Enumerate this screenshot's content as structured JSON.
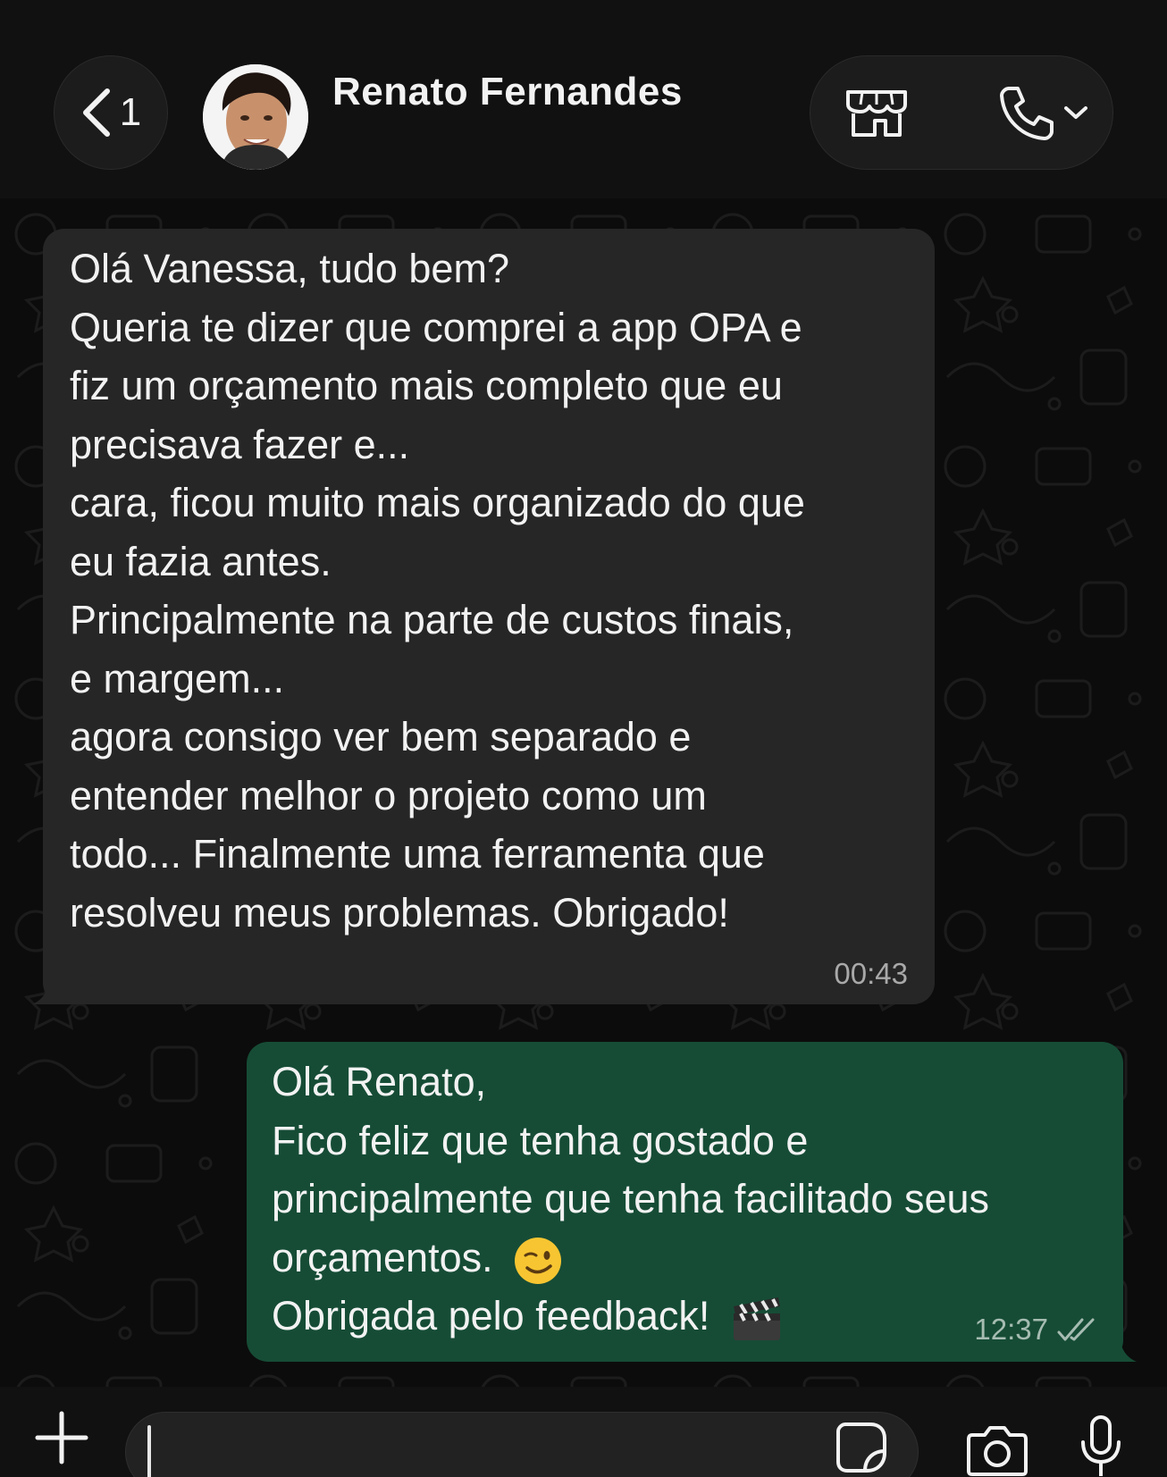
{
  "header": {
    "back_count": "1",
    "contact_name": "Renato Fernandes",
    "icons": {
      "back": "chevron-left-icon",
      "store": "storefront-icon",
      "call": "phone-icon",
      "call_menu": "chevron-down-icon"
    }
  },
  "messages": [
    {
      "direction": "incoming",
      "lines": [
        "Olá Vanessa, tudo bem?",
        "Queria te dizer que comprei a app OPA e",
        "fiz um orçamento mais completo que eu",
        "precisava fazer e...",
        "cara, ficou muito mais organizado do que",
        "eu fazia antes.",
        "Principalmente na parte de custos finais,",
        "e margem...",
        "agora consigo ver bem separado e",
        "entender melhor o projeto como um",
        "todo... Finalmente uma ferramenta que",
        "resolveu meus problemas. Obrigado!"
      ],
      "time": "00:43"
    },
    {
      "direction": "outgoing",
      "lines": [
        "Olá Renato,",
        "Fico feliz que tenha gostado e",
        "principalmente que tenha facilitado seus",
        "orçamentos.",
        "Obrigada pelo feedback!"
      ],
      "time": "12:37",
      "status": "read-double-check-icon",
      "emojis": [
        "winking-face-emoji",
        "clapper-board-emoji"
      ]
    }
  ],
  "input_bar": {
    "value": "",
    "icons": {
      "attach": "plus-icon",
      "sticker": "sticker-icon",
      "camera": "camera-icon",
      "mic": "microphone-icon"
    }
  },
  "colors": {
    "background": "#0c0c0c",
    "incoming_bubble": "#262626",
    "outgoing_bubble": "#164c36",
    "text": "#f2f2f2"
  }
}
